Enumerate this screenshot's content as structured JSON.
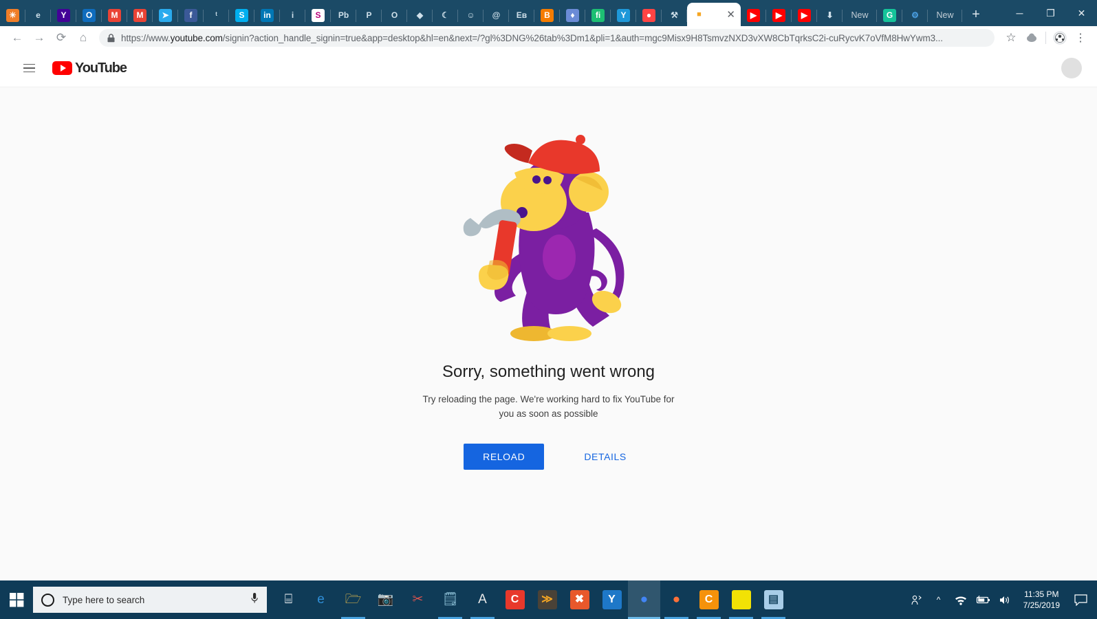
{
  "browser": {
    "tabs": [
      {
        "icon": "sun-burst-icon",
        "bg": "#f07e28",
        "glyph": "☀"
      },
      {
        "icon": "edge-legacy-icon",
        "bg": "#1b4a66",
        "glyph": "e"
      },
      {
        "icon": "yahoo-icon",
        "bg": "#430297",
        "glyph": "Y"
      },
      {
        "icon": "outlook-icon",
        "bg": "#0f6cbd",
        "glyph": "O"
      },
      {
        "icon": "gmail-icon",
        "bg": "#ea4335",
        "glyph": "M"
      },
      {
        "icon": "gmail-icon",
        "bg": "#ea4335",
        "glyph": "M"
      },
      {
        "icon": "telegram-icon",
        "bg": "#2aabee",
        "glyph": "➤"
      },
      {
        "icon": "facebook-icon",
        "bg": "#3b5998",
        "glyph": "f"
      },
      {
        "icon": "twitter-icon",
        "bg": "#1b4a66",
        "glyph": "ᵗ"
      },
      {
        "icon": "skype-icon",
        "bg": "#00aff0",
        "glyph": "S"
      },
      {
        "icon": "linkedin-icon",
        "bg": "#0077b5",
        "glyph": "in"
      },
      {
        "icon": "info-icon",
        "bg": "#1b4a66",
        "glyph": "i"
      },
      {
        "icon": "s-letter-icon",
        "bg": "#ffffff",
        "glyph": "S"
      },
      {
        "icon": "peoplebox-icon",
        "bg": "#1b4a66",
        "glyph": "Pb"
      },
      {
        "icon": "paypal-icon",
        "bg": "#1b4a66",
        "glyph": "P"
      },
      {
        "icon": "circle-o-icon",
        "bg": "#1b4a66",
        "glyph": "O"
      },
      {
        "icon": "diamond-blue-icon",
        "bg": "#1b4a66",
        "glyph": "◆"
      },
      {
        "icon": "moon-icon",
        "bg": "#1b4a66",
        "glyph": "☾"
      },
      {
        "icon": "smiley-icon",
        "bg": "#1b4a66",
        "glyph": "☺"
      },
      {
        "icon": "swirl-orange-icon",
        "bg": "#1b4a66",
        "glyph": "@"
      },
      {
        "icon": "eb-icon",
        "bg": "#1b4a66",
        "glyph": "Eʙ"
      },
      {
        "icon": "blogger-icon",
        "bg": "#f57c00",
        "glyph": "B"
      },
      {
        "icon": "diamond-icon",
        "bg": "#6b8bd6",
        "glyph": "♦"
      },
      {
        "icon": "fiverr-icon",
        "bg": "#1dbf73",
        "glyph": "fi"
      },
      {
        "icon": "yandex-mail-icon",
        "bg": "#1e98d9",
        "glyph": "Y"
      },
      {
        "icon": "red-face-icon",
        "bg": "#ff4444",
        "glyph": "●"
      },
      {
        "icon": "crossed-tools-icon",
        "bg": "#1b4a66",
        "glyph": "⚒"
      }
    ],
    "active_tab": {
      "icon": "active-tab-favicon",
      "close_label": "✕"
    },
    "tabs_after": [
      {
        "icon": "youtube-icon",
        "bg": "#ff0000",
        "glyph": "▶"
      },
      {
        "icon": "youtube-icon",
        "bg": "#ff0000",
        "glyph": "▶"
      },
      {
        "icon": "youtube-icon",
        "bg": "#ff0000",
        "glyph": "▶"
      },
      {
        "icon": "download-icon",
        "bg": "#1b4a66",
        "glyph": "⬇"
      }
    ],
    "named_tabs": [
      {
        "label": "New"
      },
      {
        "icon": "grammarly-icon",
        "bg": "#15c39a",
        "glyph": "G"
      },
      {
        "icon": "settings-gear-icon",
        "bg": "#1b4a66",
        "glyph": "⚙"
      },
      {
        "label": "New"
      }
    ],
    "new_tab_label": "+",
    "window_controls": {
      "minimize": "─",
      "maximize": "❐",
      "close": "✕"
    },
    "nav": {
      "back": "←",
      "forward": "→",
      "reload": "⟳",
      "home": "⌂"
    },
    "omnibox": {
      "lock_icon": "lock-icon",
      "url_scheme": "https://www.",
      "url_domain": "youtube.com",
      "url_path": "/signin?action_handle_signin=true&app=desktop&hl=en&next=/?gl%3DNG%26tab%3Dm1&pli=1&auth=mgc9Misx9H8TsmvzNXD3vXW8CbTqrksC2i-cuRycvK7oVfM8HwYwm3..."
    },
    "toolbar_icons": [
      {
        "name": "bookmark-star-icon",
        "glyph": "☆"
      },
      {
        "name": "extension-icon",
        "glyph": "●"
      },
      {
        "name": "profile-avatar-icon",
        "glyph": "⚽"
      },
      {
        "name": "chrome-menu-icon",
        "glyph": "⋮"
      }
    ]
  },
  "youtube": {
    "menu_icon": "hamburger-menu-icon",
    "logo_text": "YouTube",
    "logo_icon": "youtube-play-icon",
    "avatar_icon": "user-avatar-icon"
  },
  "error_page": {
    "illustration": "monkey-with-hammer-illustration",
    "title": "Sorry, something went wrong",
    "subtitle": "Try reloading the page. We're working hard to fix YouTube for you as soon as possible",
    "reload_label": "RELOAD",
    "details_label": "DETAILS",
    "accent_color": "#1565e0",
    "colors": {
      "monkey_body": "#7b1fa2",
      "monkey_body_light": "#9c27b0",
      "monkey_skin": "#fbd14b",
      "monkey_skin_dark": "#eeb730",
      "cap": "#e8382b",
      "cap_dark": "#c42a1f",
      "hammer_head": "#b0bec5",
      "hammer_handle": "#e8382b"
    }
  },
  "taskbar": {
    "start_icon": "windows-start-icon",
    "search": {
      "cortana_icon": "cortana-circle-icon",
      "placeholder": "Type here to search",
      "mic_icon": "microphone-icon"
    },
    "apps": [
      {
        "name": "task-view-icon",
        "bg": "transparent",
        "glyph": "⌸",
        "color": "#ffffff",
        "running": false
      },
      {
        "name": "edge-icon",
        "bg": "transparent",
        "glyph": "e",
        "color": "#2f8fd8",
        "running": false
      },
      {
        "name": "file-explorer-icon",
        "bg": "transparent",
        "glyph": "🗁",
        "color": "#f5c44a",
        "running": true
      },
      {
        "name": "camera-icon",
        "bg": "transparent",
        "glyph": "📷",
        "color": "#ffffff",
        "running": false
      },
      {
        "name": "snipping-tool-icon",
        "bg": "transparent",
        "glyph": "✂",
        "color": "#d9534f",
        "running": false
      },
      {
        "name": "sticky-notes-icon",
        "bg": "transparent",
        "glyph": "🗒",
        "color": "#9fd3e8",
        "running": true
      },
      {
        "name": "font-viewer-icon",
        "bg": "transparent",
        "glyph": "A",
        "color": "#e8e8e8",
        "running": true
      },
      {
        "name": "camtasia-icon",
        "bg": "#e8382b",
        "glyph": "C",
        "color": "#ffffff",
        "running": false
      },
      {
        "name": "sublime-text-icon",
        "bg": "#4a4237",
        "glyph": "≫",
        "color": "#f5a623",
        "running": false
      },
      {
        "name": "xampp-icon",
        "bg": "#e8582b",
        "glyph": "✖",
        "color": "#ffffff",
        "running": false
      },
      {
        "name": "yandex-browser-icon",
        "bg": "#1e78c8",
        "glyph": "Y",
        "color": "#ffffff",
        "running": false
      },
      {
        "name": "chrome-icon",
        "bg": "transparent",
        "glyph": "●",
        "color": "#4285f4",
        "running": false,
        "active": true
      },
      {
        "name": "firefox-icon",
        "bg": "transparent",
        "glyph": "●",
        "color": "#ff7139",
        "running": true
      },
      {
        "name": "ccleaner-icon",
        "bg": "#f5920b",
        "glyph": "C",
        "color": "#ffffff",
        "running": true
      },
      {
        "name": "notes-yellow-icon",
        "bg": "#f2e205",
        "glyph": " ",
        "color": "#333333",
        "running": true
      },
      {
        "name": "presentation-icon",
        "bg": "#a8cde8",
        "glyph": "▤",
        "color": "#1b4a66",
        "running": true
      }
    ],
    "tray": [
      {
        "name": "people-share-icon",
        "glyph": "ʀ"
      },
      {
        "name": "show-hidden-icons-chevron",
        "glyph": "∧"
      },
      {
        "name": "wifi-icon",
        "glyph": "◠"
      },
      {
        "name": "battery-icon",
        "glyph": "▭"
      },
      {
        "name": "volume-icon",
        "glyph": "🔊"
      }
    ],
    "clock": {
      "time": "11:35 PM",
      "date": "7/25/2019"
    },
    "action_center_icon": "action-center-icon"
  }
}
